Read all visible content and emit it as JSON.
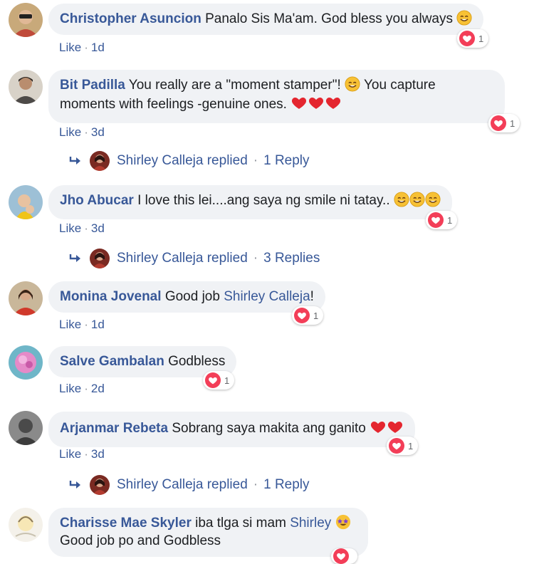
{
  "accent_color": "#385898",
  "bubble_color": "#f0f2f5",
  "heart_color": "#f33e58",
  "comments": [
    {
      "author": "Christopher Asuncion",
      "text": "Panalo Sis Ma'am. God bless you always",
      "like": "Like",
      "time": "1d",
      "reaction_count": "1"
    },
    {
      "author": "Bit Padilla",
      "text_line1": "You really are a \"moment stamper\"!",
      "text_line1b": "You capture",
      "text_line2": "moments with feelings -genuine ones.",
      "like": "Like",
      "time": "3d",
      "reaction_count": "1",
      "replies": {
        "name": "Shirley Calleja",
        "verb": "replied",
        "count": "1 Reply"
      }
    },
    {
      "author": "Jho Abucar",
      "text": "I love this lei....ang saya ng smile ni tatay..",
      "like": "Like",
      "time": "3d",
      "reaction_count": "1",
      "replies": {
        "name": "Shirley Calleja",
        "verb": "replied",
        "count": "3 Replies"
      }
    },
    {
      "author": "Monina Jovenal",
      "text": "Good job",
      "mention": "Shirley Calleja",
      "suffix": "!",
      "like": "Like",
      "time": "1d",
      "reaction_count": "1"
    },
    {
      "author": "Salve Gambalan",
      "text": "Godbless",
      "like": "Like",
      "time": "2d",
      "reaction_count": "1"
    },
    {
      "author": "Arjanmar Rebeta",
      "text": "Sobrang saya makita ang ganito",
      "like": "Like",
      "time": "3d",
      "reaction_count": "1",
      "replies": {
        "name": "Shirley Calleja",
        "verb": "replied",
        "count": "1 Reply"
      }
    },
    {
      "author": "Charisse Mae Skyler",
      "text": "iba tlga si mam",
      "mention": "Shirley",
      "text_line2": "Good job po and Godbless"
    }
  ]
}
